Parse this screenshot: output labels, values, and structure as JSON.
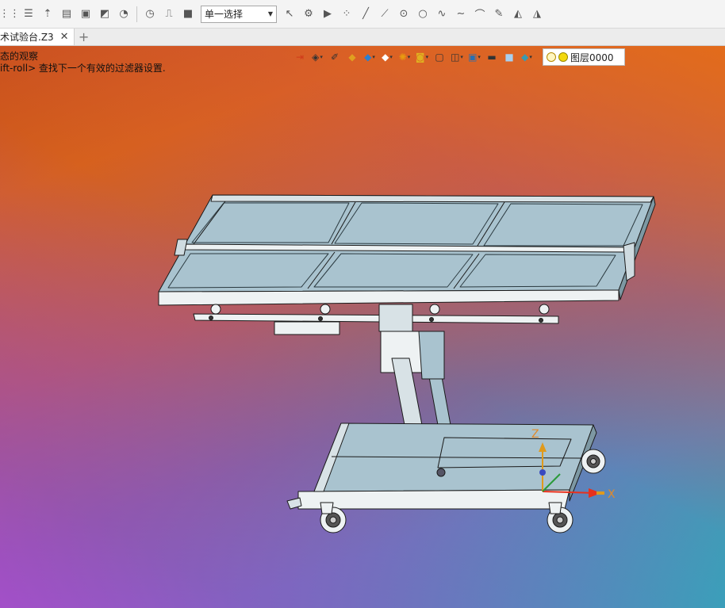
{
  "toolbar": {
    "selection_mode": "单一选择"
  },
  "tabs": [
    {
      "label": "术试验台.Z3"
    }
  ],
  "add_tab_label": "+",
  "doc_tab_close": "✕",
  "status": {
    "line1": "态的观察",
    "line2": "ift-roll> 查找下一个有效的过滤器设置."
  },
  "layer": {
    "name": "图层0000"
  },
  "axes": {
    "z": "Z",
    "x": "X"
  },
  "colors": {
    "part_fill": "#a9c3cf",
    "part_stroke": "#1a1a1a",
    "frame_white": "#eef2f3",
    "axis_x": "#e8301c",
    "axis_z": "#e09a1c",
    "axis_label": "#e08a2c"
  }
}
